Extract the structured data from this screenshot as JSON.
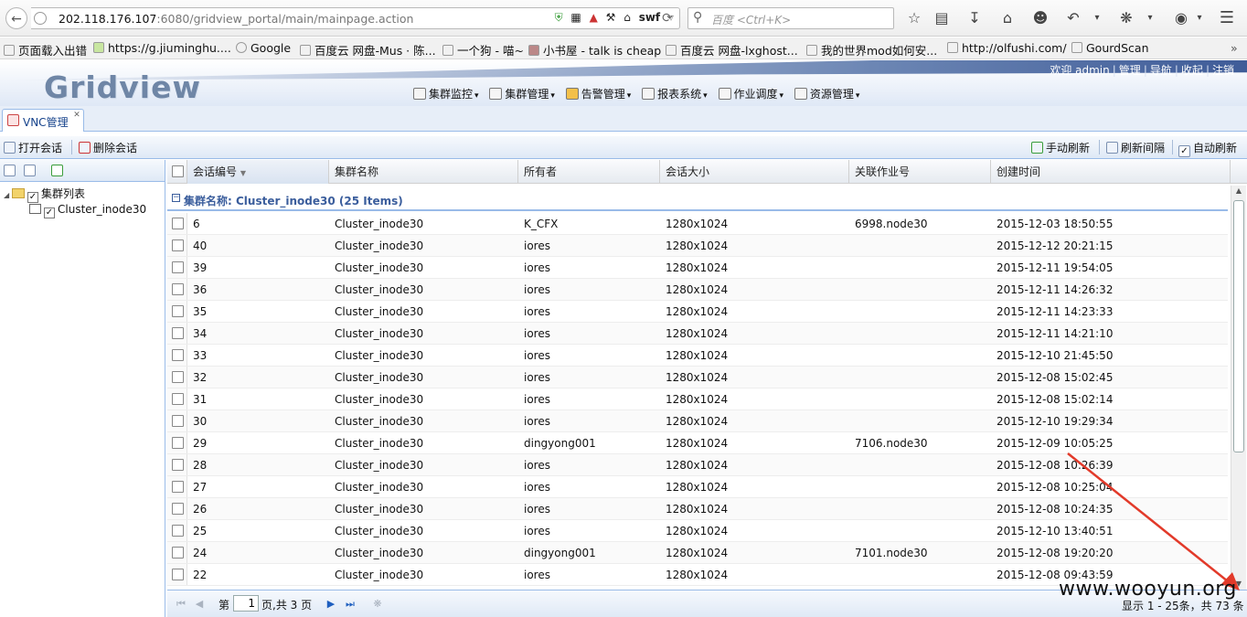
{
  "browser": {
    "url_host": "202.118.176.107",
    "url_rest": ":6080/gridview_portal/main/mainpage.action",
    "url_badge": "swf",
    "search_placeholder": "百度 <Ctrl+K>",
    "bookmarks": [
      "页面载入出错",
      "https://g.jiuminghu....",
      "Google",
      "百度云 网盘-Mus · 陈...",
      "一个狗 - 喵~",
      "小书屋 - talk is cheap",
      "百度云 网盘-lxghost...",
      "我的世界mod如何安...",
      "http://olfushi.com/",
      "GourdScan"
    ]
  },
  "app": {
    "logo": "Gridview",
    "user_links": [
      "欢迎 admin",
      "管理",
      "导航",
      "收起",
      "注销"
    ],
    "menu": [
      "集群监控",
      "集群管理",
      "告警管理",
      "报表系统",
      "作业调度",
      "资源管理"
    ],
    "tab_label": "VNC管理"
  },
  "toolbar": {
    "open_session": "打开会话",
    "delete_session": "删除会话",
    "manual_refresh": "手动刷新",
    "refresh_interval": "刷新间隔",
    "auto_refresh": "自动刷新"
  },
  "tree": {
    "root": "集群列表",
    "child": "Cluster_inode30"
  },
  "grid": {
    "columns": [
      "会话编号",
      "集群名称",
      "所有者",
      "会话大小",
      "关联作业号",
      "创建时间"
    ],
    "group_label": "集群名称: Cluster_inode30 (25 Items)",
    "rows": [
      {
        "id": "6",
        "cluster": "Cluster_inode30",
        "owner": "K_CFX",
        "size": "1280x1024",
        "job": "6998.node30",
        "created": "2015-12-03 18:50:55"
      },
      {
        "id": "40",
        "cluster": "Cluster_inode30",
        "owner": "iores",
        "size": "1280x1024",
        "job": "",
        "created": "2015-12-12 20:21:15"
      },
      {
        "id": "39",
        "cluster": "Cluster_inode30",
        "owner": "iores",
        "size": "1280x1024",
        "job": "",
        "created": "2015-12-11 19:54:05"
      },
      {
        "id": "36",
        "cluster": "Cluster_inode30",
        "owner": "iores",
        "size": "1280x1024",
        "job": "",
        "created": "2015-12-11 14:26:32"
      },
      {
        "id": "35",
        "cluster": "Cluster_inode30",
        "owner": "iores",
        "size": "1280x1024",
        "job": "",
        "created": "2015-12-11 14:23:33"
      },
      {
        "id": "34",
        "cluster": "Cluster_inode30",
        "owner": "iores",
        "size": "1280x1024",
        "job": "",
        "created": "2015-12-11 14:21:10"
      },
      {
        "id": "33",
        "cluster": "Cluster_inode30",
        "owner": "iores",
        "size": "1280x1024",
        "job": "",
        "created": "2015-12-10 21:45:50"
      },
      {
        "id": "32",
        "cluster": "Cluster_inode30",
        "owner": "iores",
        "size": "1280x1024",
        "job": "",
        "created": "2015-12-08 15:02:45"
      },
      {
        "id": "31",
        "cluster": "Cluster_inode30",
        "owner": "iores",
        "size": "1280x1024",
        "job": "",
        "created": "2015-12-08 15:02:14"
      },
      {
        "id": "30",
        "cluster": "Cluster_inode30",
        "owner": "iores",
        "size": "1280x1024",
        "job": "",
        "created": "2015-12-10 19:29:34"
      },
      {
        "id": "29",
        "cluster": "Cluster_inode30",
        "owner": "dingyong001",
        "size": "1280x1024",
        "job": "7106.node30",
        "created": "2015-12-09 10:05:25"
      },
      {
        "id": "28",
        "cluster": "Cluster_inode30",
        "owner": "iores",
        "size": "1280x1024",
        "job": "",
        "created": "2015-12-08 10:26:39"
      },
      {
        "id": "27",
        "cluster": "Cluster_inode30",
        "owner": "iores",
        "size": "1280x1024",
        "job": "",
        "created": "2015-12-08 10:25:04"
      },
      {
        "id": "26",
        "cluster": "Cluster_inode30",
        "owner": "iores",
        "size": "1280x1024",
        "job": "",
        "created": "2015-12-08 10:24:35"
      },
      {
        "id": "25",
        "cluster": "Cluster_inode30",
        "owner": "iores",
        "size": "1280x1024",
        "job": "",
        "created": "2015-12-10 13:40:51"
      },
      {
        "id": "24",
        "cluster": "Cluster_inode30",
        "owner": "dingyong001",
        "size": "1280x1024",
        "job": "7101.node30",
        "created": "2015-12-08 19:20:20"
      },
      {
        "id": "22",
        "cluster": "Cluster_inode30",
        "owner": "iores",
        "size": "1280x1024",
        "job": "",
        "created": "2015-12-08 09:43:59"
      }
    ]
  },
  "pager": {
    "page_prefix": "第",
    "page_value": "1",
    "page_suffix": "页,共 3 页",
    "summary": "显示 1 - 25条，共 73 条"
  },
  "watermark": "www.wooyun.org"
}
